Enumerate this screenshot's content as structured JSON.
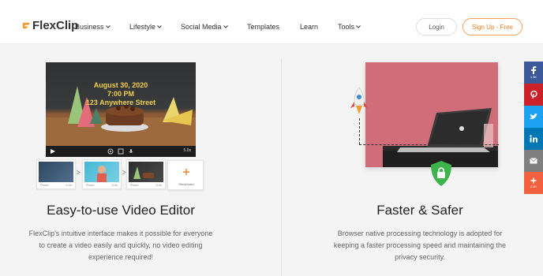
{
  "header": {
    "logo_text": "FlexClip",
    "nav": [
      {
        "label": "Business",
        "has_dropdown": true
      },
      {
        "label": "Lifestyle",
        "has_dropdown": true
      },
      {
        "label": "Social Media",
        "has_dropdown": true
      },
      {
        "label": "Templates",
        "has_dropdown": false
      },
      {
        "label": "Learn",
        "has_dropdown": false
      },
      {
        "label": "Tools",
        "has_dropdown": true
      }
    ],
    "login_label": "Login",
    "signup_label": "Sign Up - Free"
  },
  "left_feature": {
    "video_lines": [
      "August 30, 2020",
      "7:00 PM",
      "123 Anywhere Street"
    ],
    "video_duration": "5.0s",
    "timeline": [
      {
        "caption": "Photo",
        "duration": "4.0s"
      },
      {
        "caption": "Photo",
        "duration": "5.0s"
      },
      {
        "caption": "Photo",
        "duration": "5.0s"
      }
    ],
    "storyboard_label": "Storyboard",
    "title": "Easy-to-use Video Editor",
    "description": [
      "FlexClip's intuitive interface makes it possible for everyone",
      "to create a video easily and quickly, no video editing",
      "experience required!"
    ]
  },
  "right_feature": {
    "title": "Faster & Safer",
    "description": [
      "Browser native processing technology is adopted for",
      "keeping a faster processing speed and maintaining the",
      "privacy security."
    ]
  },
  "share_bar": [
    {
      "icon": "facebook-icon",
      "count": "1.5K",
      "color": "#3b5998"
    },
    {
      "icon": "pinterest-icon",
      "count": "",
      "color": "#cb2027"
    },
    {
      "icon": "twitter-icon",
      "count": "",
      "color": "#1da1f2"
    },
    {
      "icon": "linkedin-icon",
      "count": "",
      "color": "#0077b5"
    },
    {
      "icon": "email-icon",
      "count": "",
      "color": "#7f7f7f"
    },
    {
      "icon": "plus-icon",
      "count": "2.5K",
      "color": "#f2603e"
    }
  ],
  "colors": {
    "accent": "#ee7e28",
    "shield": "#3cb44b",
    "card_red": "#d06d78"
  }
}
